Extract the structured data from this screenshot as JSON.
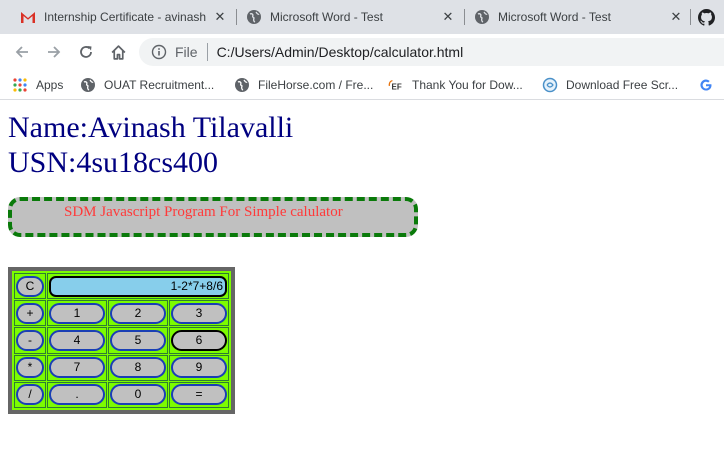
{
  "tabs": [
    {
      "title": "Internship Certificate - avinash",
      "icon": "gmail-icon"
    },
    {
      "title": "Microsoft Word - Test",
      "icon": "globe-icon"
    },
    {
      "title": "Microsoft Word - Test",
      "icon": "globe-icon"
    }
  ],
  "tab_close_symbol": "✕",
  "address": {
    "scheme_label": "File",
    "url": "C:/Users/Admin/Desktop/calculator.html"
  },
  "bookmarks": [
    {
      "label": "Apps",
      "icon": "apps-grid-icon"
    },
    {
      "label": "OUAT Recruitment...",
      "icon": "globe-icon"
    },
    {
      "label": "FileHorse.com / Fre...",
      "icon": "globe-icon"
    },
    {
      "label": "Thank You for Dow...",
      "icon": "ef-logo-icon"
    },
    {
      "label": "Download Free Scr...",
      "icon": "download-site-icon"
    },
    {
      "label": "G",
      "icon": "google-icon"
    }
  ],
  "page": {
    "name_line": "Name:Avinash Tilavalli",
    "usn_line": "USN:4su18cs400",
    "banner": "SDM Javascript Program For Simple calulator"
  },
  "calculator": {
    "clear_label": "C",
    "display_value": "1-2*7+8/6",
    "rows": [
      [
        "+",
        "1",
        "2",
        "3"
      ],
      [
        "-",
        "4",
        "5",
        "6"
      ],
      [
        "*",
        "7",
        "8",
        "9"
      ],
      [
        "/",
        ".",
        "0",
        "="
      ]
    ]
  },
  "colors": {
    "heading": "#000080",
    "banner_text": "#ff3a3a",
    "calc_bg": "#7cfc00",
    "display_bg": "#87ceeb"
  }
}
